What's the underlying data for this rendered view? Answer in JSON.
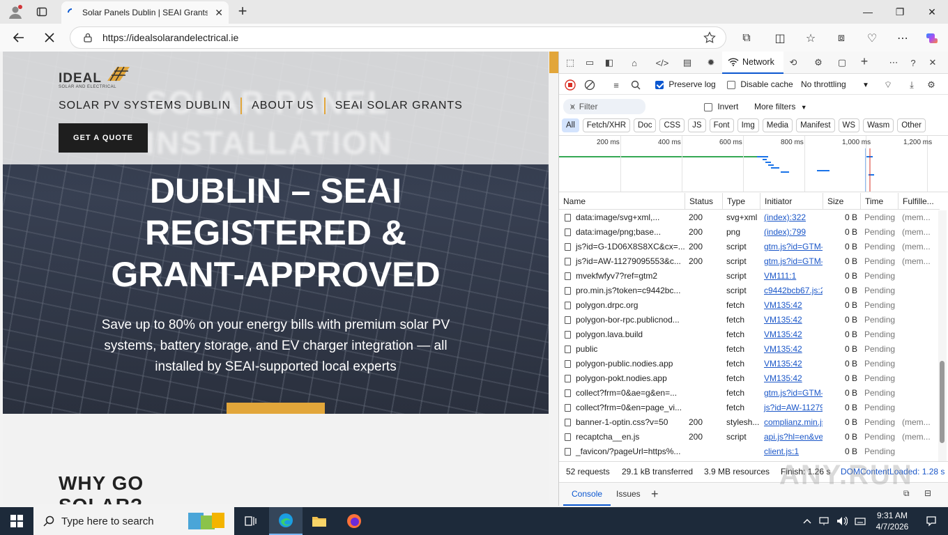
{
  "browser": {
    "tab_title": "Solar Panels Dublin | SEAI Grants & Installation",
    "url": "https://idealsolarandelectrical.ie",
    "new_tab": "+"
  },
  "site": {
    "logo_text": "IDEAL",
    "logo_sub": "SOLAR AND ELECTRICAL",
    "nav": [
      "SOLAR PV SYSTEMS DUBLIN",
      "ABOUT US",
      "SEAI SOLAR GRANTS"
    ],
    "quote_button": "GET A QUOTE",
    "ghost_title": "SOLAR PANEL INSTALLATION",
    "hero_title_lines": [
      "DUBLIN – SEAI",
      "REGISTERED &",
      "GRANT-APPROVED"
    ],
    "hero_subtitle": "Save up to 80% on your energy bills with premium solar PV systems, battery storage, and EV charger integration — all installed by SEAI-supported local experts",
    "section_heading": "WHY GO SOLAR?"
  },
  "devtools": {
    "network_tab": "Network",
    "preserve_log": "Preserve log",
    "preserve_log_checked": true,
    "disable_cache": "Disable cache",
    "disable_cache_checked": false,
    "throttling": "No throttling",
    "filter_placeholder": "Filter",
    "invert": "Invert",
    "more_filters": "More filters",
    "types": [
      "All",
      "Fetch/XHR",
      "Doc",
      "CSS",
      "JS",
      "Font",
      "Img",
      "Media",
      "Manifest",
      "WS",
      "Wasm",
      "Other"
    ],
    "active_type": "All",
    "timeline_labels": [
      "200 ms",
      "400 ms",
      "600 ms",
      "800 ms",
      "1,000 ms",
      "1,200 ms"
    ],
    "columns": [
      "Name",
      "Status",
      "Type",
      "Initiator",
      "Size",
      "Time",
      "Fulfille..."
    ],
    "rows": [
      {
        "name": "data:image/svg+xml,...",
        "status": "200",
        "type": "svg+xml",
        "initiator": "(index):322",
        "size": "0 B",
        "time": "Pending",
        "fulfilled": "(mem..."
      },
      {
        "name": "data:image/png;base...",
        "status": "200",
        "type": "png",
        "initiator": "(index):799",
        "size": "0 B",
        "time": "Pending",
        "fulfilled": "(mem..."
      },
      {
        "name": "js?id=G-1D06X8S8XC&cx=...",
        "status": "200",
        "type": "script",
        "initiator": "gtm.js?id=GTM-",
        "size": "0 B",
        "time": "Pending",
        "fulfilled": "(mem..."
      },
      {
        "name": "js?id=AW-11279095553&c...",
        "status": "200",
        "type": "script",
        "initiator": "gtm.js?id=GTM-",
        "size": "0 B",
        "time": "Pending",
        "fulfilled": "(mem..."
      },
      {
        "name": "mvekfwfyv7?ref=gtm2",
        "status": "",
        "type": "script",
        "initiator": "VM111:1",
        "size": "0 B",
        "time": "Pending",
        "fulfilled": ""
      },
      {
        "name": "pro.min.js?token=c9442bc...",
        "status": "",
        "type": "script",
        "initiator": "c9442bcb67.js:2",
        "size": "0 B",
        "time": "Pending",
        "fulfilled": ""
      },
      {
        "name": "polygon.drpc.org",
        "status": "",
        "type": "fetch",
        "initiator": "VM135:42",
        "size": "0 B",
        "time": "Pending",
        "fulfilled": ""
      },
      {
        "name": "polygon-bor-rpc.publicnod...",
        "status": "",
        "type": "fetch",
        "initiator": "VM135:42",
        "size": "0 B",
        "time": "Pending",
        "fulfilled": ""
      },
      {
        "name": "polygon.lava.build",
        "status": "",
        "type": "fetch",
        "initiator": "VM135:42",
        "size": "0 B",
        "time": "Pending",
        "fulfilled": ""
      },
      {
        "name": "public",
        "status": "",
        "type": "fetch",
        "initiator": "VM135:42",
        "size": "0 B",
        "time": "Pending",
        "fulfilled": ""
      },
      {
        "name": "polygon-public.nodies.app",
        "status": "",
        "type": "fetch",
        "initiator": "VM135:42",
        "size": "0 B",
        "time": "Pending",
        "fulfilled": ""
      },
      {
        "name": "polygon-pokt.nodies.app",
        "status": "",
        "type": "fetch",
        "initiator": "VM135:42",
        "size": "0 B",
        "time": "Pending",
        "fulfilled": ""
      },
      {
        "name": "collect?frm=0&ae=g&en=...",
        "status": "",
        "type": "fetch",
        "initiator": "gtm.js?id=GTM-",
        "size": "0 B",
        "time": "Pending",
        "fulfilled": ""
      },
      {
        "name": "collect?frm=0&en=page_vi...",
        "status": "",
        "type": "fetch",
        "initiator": "js?id=AW-11279",
        "size": "0 B",
        "time": "Pending",
        "fulfilled": ""
      },
      {
        "name": "banner-1-optin.css?v=50",
        "status": "200",
        "type": "stylesh...",
        "initiator": "complianz.min.js",
        "size": "0 B",
        "time": "Pending",
        "fulfilled": "(mem..."
      },
      {
        "name": "recaptcha__en.js",
        "status": "200",
        "type": "script",
        "initiator": "api.js?hl=en&ve",
        "size": "0 B",
        "time": "Pending",
        "fulfilled": "(mem..."
      },
      {
        "name": "_favicon/?pageUrl=https%...",
        "status": "",
        "type": "",
        "initiator": "client.js:1",
        "size": "0 B",
        "time": "Pending",
        "fulfilled": ""
      }
    ],
    "status_requests": "52 requests",
    "status_transferred": "29.1 kB transferred",
    "status_resources": "3.9 MB resources",
    "status_finish": "Finish: 1.26 s",
    "status_dcl": "DOMContentLoaded: 1.28 s",
    "drawer_tabs": [
      "Console",
      "Issues"
    ]
  },
  "taskbar": {
    "search_placeholder": "Type here to search",
    "time": "9:31 AM",
    "date": "4/7/2026"
  },
  "watermark": "ANY.RUN",
  "colors": {
    "accent": "#e2a63a",
    "devtools_blue": "#0b57d0",
    "taskbar": "#1d2a3a"
  }
}
